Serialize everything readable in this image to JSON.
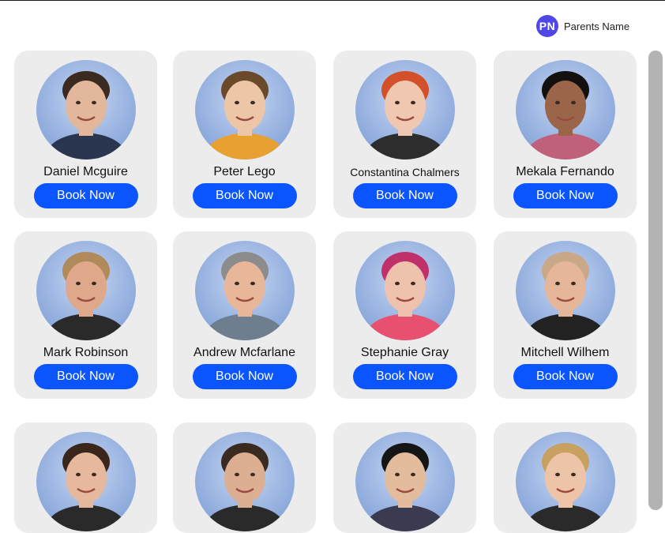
{
  "header": {
    "user": {
      "initials": "PN",
      "name": "Parents Name"
    }
  },
  "colors": {
    "accent": "#0a55ff",
    "avatar": "#5146e6",
    "card_bg": "#ececec"
  },
  "teachers": [
    {
      "name": "Daniel Mcguire",
      "book_label": "Book Now",
      "hair": "#3a2a20",
      "skin": "#e2b79b",
      "shirt": "#2a3550"
    },
    {
      "name": "Peter Lego",
      "book_label": "Book Now",
      "hair": "#6b4a2c",
      "skin": "#edc6a8",
      "shirt": "#e8a030"
    },
    {
      "name": "Constantina Chalmers",
      "book_label": "Book Now",
      "hair": "#d2502a",
      "skin": "#f0c8b2",
      "shirt": "#2d2d2d"
    },
    {
      "name": "Mekala Fernando",
      "book_label": "Book Now",
      "hair": "#141010",
      "skin": "#9a6548",
      "shirt": "#c0607a"
    },
    {
      "name": "Mark Robinson",
      "book_label": "Book Now",
      "hair": "#b08a5a",
      "skin": "#e0a88a",
      "shirt": "#2a2a2a"
    },
    {
      "name": "Andrew Mcfarlane",
      "book_label": "Book Now",
      "hair": "#8c8c8c",
      "skin": "#e8b79a",
      "shirt": "#6e7e8e"
    },
    {
      "name": "Stephanie Gray",
      "book_label": "Book Now",
      "hair": "#c0306a",
      "skin": "#efc2ae",
      "shirt": "#e85070"
    },
    {
      "name": "Mitchell Wilhem",
      "book_label": "Book Now",
      "hair": "#c8a888",
      "skin": "#e6b69a",
      "shirt": "#222222"
    },
    {
      "name": "",
      "book_label": "",
      "hair": "#3a261a",
      "skin": "#e6b89e",
      "shirt": "#2a2a2a"
    },
    {
      "name": "",
      "book_label": "",
      "hair": "#3a2a20",
      "skin": "#dcae92",
      "shirt": "#2a2a2a"
    },
    {
      "name": "",
      "book_label": "",
      "hair": "#151515",
      "skin": "#e2bc9c",
      "shirt": "#3a3a50"
    },
    {
      "name": "",
      "book_label": "",
      "hair": "#c8a060",
      "skin": "#eec4a8",
      "shirt": "#2a2a2a"
    }
  ]
}
